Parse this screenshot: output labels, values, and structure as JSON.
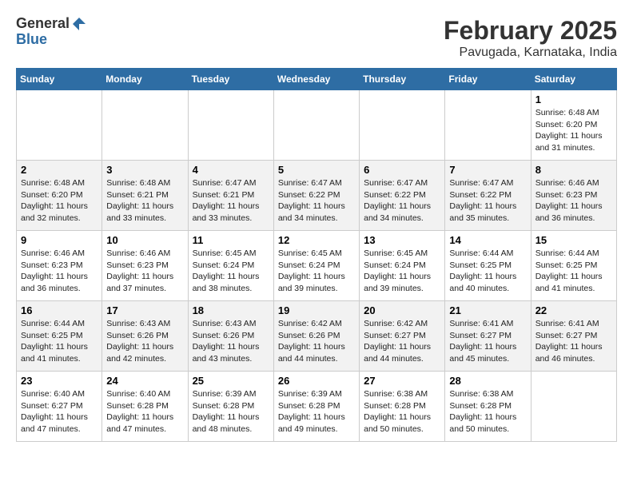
{
  "header": {
    "logo_line1": "General",
    "logo_line2": "Blue",
    "month_title": "February 2025",
    "location": "Pavugada, Karnataka, India"
  },
  "days_of_week": [
    "Sunday",
    "Monday",
    "Tuesday",
    "Wednesday",
    "Thursday",
    "Friday",
    "Saturday"
  ],
  "weeks": [
    [
      {
        "day": "",
        "info": ""
      },
      {
        "day": "",
        "info": ""
      },
      {
        "day": "",
        "info": ""
      },
      {
        "day": "",
        "info": ""
      },
      {
        "day": "",
        "info": ""
      },
      {
        "day": "",
        "info": ""
      },
      {
        "day": "1",
        "info": "Sunrise: 6:48 AM\nSunset: 6:20 PM\nDaylight: 11 hours and 31 minutes."
      }
    ],
    [
      {
        "day": "2",
        "info": "Sunrise: 6:48 AM\nSunset: 6:20 PM\nDaylight: 11 hours and 32 minutes."
      },
      {
        "day": "3",
        "info": "Sunrise: 6:48 AM\nSunset: 6:21 PM\nDaylight: 11 hours and 33 minutes."
      },
      {
        "day": "4",
        "info": "Sunrise: 6:47 AM\nSunset: 6:21 PM\nDaylight: 11 hours and 33 minutes."
      },
      {
        "day": "5",
        "info": "Sunrise: 6:47 AM\nSunset: 6:22 PM\nDaylight: 11 hours and 34 minutes."
      },
      {
        "day": "6",
        "info": "Sunrise: 6:47 AM\nSunset: 6:22 PM\nDaylight: 11 hours and 34 minutes."
      },
      {
        "day": "7",
        "info": "Sunrise: 6:47 AM\nSunset: 6:22 PM\nDaylight: 11 hours and 35 minutes."
      },
      {
        "day": "8",
        "info": "Sunrise: 6:46 AM\nSunset: 6:23 PM\nDaylight: 11 hours and 36 minutes."
      }
    ],
    [
      {
        "day": "9",
        "info": "Sunrise: 6:46 AM\nSunset: 6:23 PM\nDaylight: 11 hours and 36 minutes."
      },
      {
        "day": "10",
        "info": "Sunrise: 6:46 AM\nSunset: 6:23 PM\nDaylight: 11 hours and 37 minutes."
      },
      {
        "day": "11",
        "info": "Sunrise: 6:45 AM\nSunset: 6:24 PM\nDaylight: 11 hours and 38 minutes."
      },
      {
        "day": "12",
        "info": "Sunrise: 6:45 AM\nSunset: 6:24 PM\nDaylight: 11 hours and 39 minutes."
      },
      {
        "day": "13",
        "info": "Sunrise: 6:45 AM\nSunset: 6:24 PM\nDaylight: 11 hours and 39 minutes."
      },
      {
        "day": "14",
        "info": "Sunrise: 6:44 AM\nSunset: 6:25 PM\nDaylight: 11 hours and 40 minutes."
      },
      {
        "day": "15",
        "info": "Sunrise: 6:44 AM\nSunset: 6:25 PM\nDaylight: 11 hours and 41 minutes."
      }
    ],
    [
      {
        "day": "16",
        "info": "Sunrise: 6:44 AM\nSunset: 6:25 PM\nDaylight: 11 hours and 41 minutes."
      },
      {
        "day": "17",
        "info": "Sunrise: 6:43 AM\nSunset: 6:26 PM\nDaylight: 11 hours and 42 minutes."
      },
      {
        "day": "18",
        "info": "Sunrise: 6:43 AM\nSunset: 6:26 PM\nDaylight: 11 hours and 43 minutes."
      },
      {
        "day": "19",
        "info": "Sunrise: 6:42 AM\nSunset: 6:26 PM\nDaylight: 11 hours and 44 minutes."
      },
      {
        "day": "20",
        "info": "Sunrise: 6:42 AM\nSunset: 6:27 PM\nDaylight: 11 hours and 44 minutes."
      },
      {
        "day": "21",
        "info": "Sunrise: 6:41 AM\nSunset: 6:27 PM\nDaylight: 11 hours and 45 minutes."
      },
      {
        "day": "22",
        "info": "Sunrise: 6:41 AM\nSunset: 6:27 PM\nDaylight: 11 hours and 46 minutes."
      }
    ],
    [
      {
        "day": "23",
        "info": "Sunrise: 6:40 AM\nSunset: 6:27 PM\nDaylight: 11 hours and 47 minutes."
      },
      {
        "day": "24",
        "info": "Sunrise: 6:40 AM\nSunset: 6:28 PM\nDaylight: 11 hours and 47 minutes."
      },
      {
        "day": "25",
        "info": "Sunrise: 6:39 AM\nSunset: 6:28 PM\nDaylight: 11 hours and 48 minutes."
      },
      {
        "day": "26",
        "info": "Sunrise: 6:39 AM\nSunset: 6:28 PM\nDaylight: 11 hours and 49 minutes."
      },
      {
        "day": "27",
        "info": "Sunrise: 6:38 AM\nSunset: 6:28 PM\nDaylight: 11 hours and 50 minutes."
      },
      {
        "day": "28",
        "info": "Sunrise: 6:38 AM\nSunset: 6:28 PM\nDaylight: 11 hours and 50 minutes."
      },
      {
        "day": "",
        "info": ""
      }
    ]
  ]
}
